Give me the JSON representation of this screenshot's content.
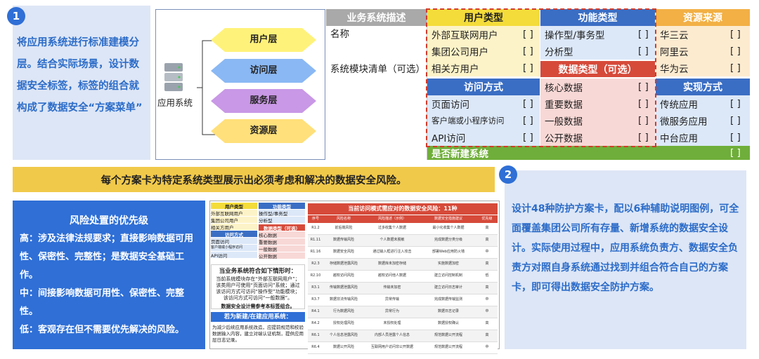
{
  "intro": {
    "badge": "1",
    "text": "将应用系统进行标准建模分层。结合实际场景，设计数据安全标签，标签的组合就构成了数据安全“方案菜单”"
  },
  "layers": {
    "app_label": "应用系统",
    "items": [
      {
        "label": "用户层",
        "color": "#fff27a"
      },
      {
        "label": "访问层",
        "color": "#8ab8f4"
      },
      {
        "label": "服务层",
        "color": "#c998e6"
      },
      {
        "label": "资源层",
        "color": "#ffe07a"
      }
    ]
  },
  "matrix": {
    "biz_header": "业务系统描述",
    "biz_rows": [
      "名称",
      "",
      "系统模块清单（可选）"
    ],
    "user_type": {
      "title": "用户类型",
      "items": [
        "外部互联网用户",
        "集团公司用户",
        "相关方用户"
      ]
    },
    "func_type": {
      "title": "功能类型",
      "items": [
        "操作型/事务型",
        "分析型"
      ]
    },
    "data_type": {
      "title": "数据类型（可选）",
      "items": [
        "核心数据",
        "重要数据",
        "一般数据",
        "公开数据"
      ]
    },
    "resource": {
      "title": "资源来源",
      "items": [
        "华三云",
        "阿里云",
        "华为云"
      ]
    },
    "access": {
      "title": "访问方式",
      "items": [
        "页面访问",
        "客户端或小程序访问",
        "API访问"
      ]
    },
    "impl": {
      "title": "实现方式",
      "items": [
        "传统应用",
        "微服务应用",
        "中台应用"
      ]
    },
    "new_system": "是否新建系统",
    "checkbox": "[   ]",
    "colors": {
      "yellow": "#f4dc3a",
      "blue": "#3a6ec4",
      "red": "#d64a3a",
      "orange": "#f2b045",
      "green": "#6fae3a",
      "pink": "#f8d8d6",
      "lightblue": "#dce8f8",
      "lightyellow": "#fdf3c8"
    }
  },
  "banner": "每个方案卡为特定系统类型展示出必须考虑和解决的数据安全风险。",
  "priority": {
    "title": "风险处置的优先级",
    "high": "高：涉及法律法规要求；直接影响数据可用性、保密性、完整性；是数据安全基础工作。",
    "mid": "中：间接影响数据可用性、保密性、完整性。",
    "low": "低：客观存在但不需要优先解决的风险。"
  },
  "card": {
    "user_title": "用户类型",
    "func_title": "功能类型",
    "user_items": [
      "外部互联网用户",
      "集团公司用户",
      "相关方用户"
    ],
    "func_items": [
      "操作型/事务型",
      "分析型"
    ],
    "access_title": "访问方式",
    "access_items": [
      "页面访问",
      "客户端或小程序访问",
      "API访问"
    ],
    "data_title": "数据类型（可选）",
    "data_items": [
      "核心数据",
      "重要数据",
      "一般数据",
      "公开数据"
    ],
    "q1_title": "当业务系统符合如下情形时：",
    "q1_text": "当前系统模块存在“外部互联网用户”；该类用户可使用“页面访问”系统；通过该访问方式可访问“操作型”功能模块；该访问方式可访问“一般数据”。",
    "q1_note": "数据安全设计需参考本标签组合。",
    "q2_title": "若为新建/在建应用系统：",
    "q2_text": "为减少后续应用系统改造，应提前规范和校验数据输入内容，建立对端认证机制，提供应用层日志记录。",
    "table_title": "当前访问模式需应对的数据安全风险：11种",
    "table_headers": [
      "序号",
      "风险名称",
      "风险描述（示例）",
      "数据安全措施建议",
      "优先级"
    ],
    "table_rows": [
      [
        "R1.2",
        "前后端风险",
        "过多收集个人数据",
        "最小化收集个人数据",
        "高"
      ],
      [
        "R1.11",
        "数据传输风险",
        "个人数据未脱敏",
        "完成数据分类分级",
        "高"
      ],
      [
        "R1.16",
        "数据安全风险",
        "通过输入框进行注入攻击",
        "部署Web应用防火墙",
        "中"
      ],
      [
        "R2.3",
        "存储数据泄露风险",
        "数据库未加密存储",
        "实施数据加密",
        "高"
      ],
      [
        "R2.10",
        "越权访问风险",
        "越权访问他人数据",
        "建立访问控制机制",
        "低"
      ],
      [
        "R3.1",
        "传输数据泄露风险",
        "传输未加密",
        "建立访问日志审计",
        "高"
      ],
      [
        "R3.7",
        "数据非法传输风险",
        "异常传输",
        "完成数据传输监测",
        "中"
      ],
      [
        "R4.1",
        "行为数据风险",
        "异常行为",
        "数据日志记录",
        "中"
      ],
      [
        "R4.2",
        "授权处理风险",
        "未授权处理",
        "数据授权确认",
        "高"
      ],
      [
        "R6.1",
        "个人信息泄露风险",
        "内部人员泄露个人信息",
        "规范数据公开流程",
        "高"
      ],
      [
        "R6.4",
        "数据公开风险",
        "互联网用户访问非公开数据",
        "规范数据公开流程",
        "中"
      ]
    ]
  },
  "summary": {
    "badge": "2",
    "text": "设计48种防护方案卡，配以6种辅助说明图例，可全面覆盖集团公司所有存量、新增系统的数据安全设计。实际使用过程中，应用系统负责方、数据安全负责方对照自身系统通过找到并组合符合自己的方案卡，即可得出数据安全防护方案。"
  }
}
